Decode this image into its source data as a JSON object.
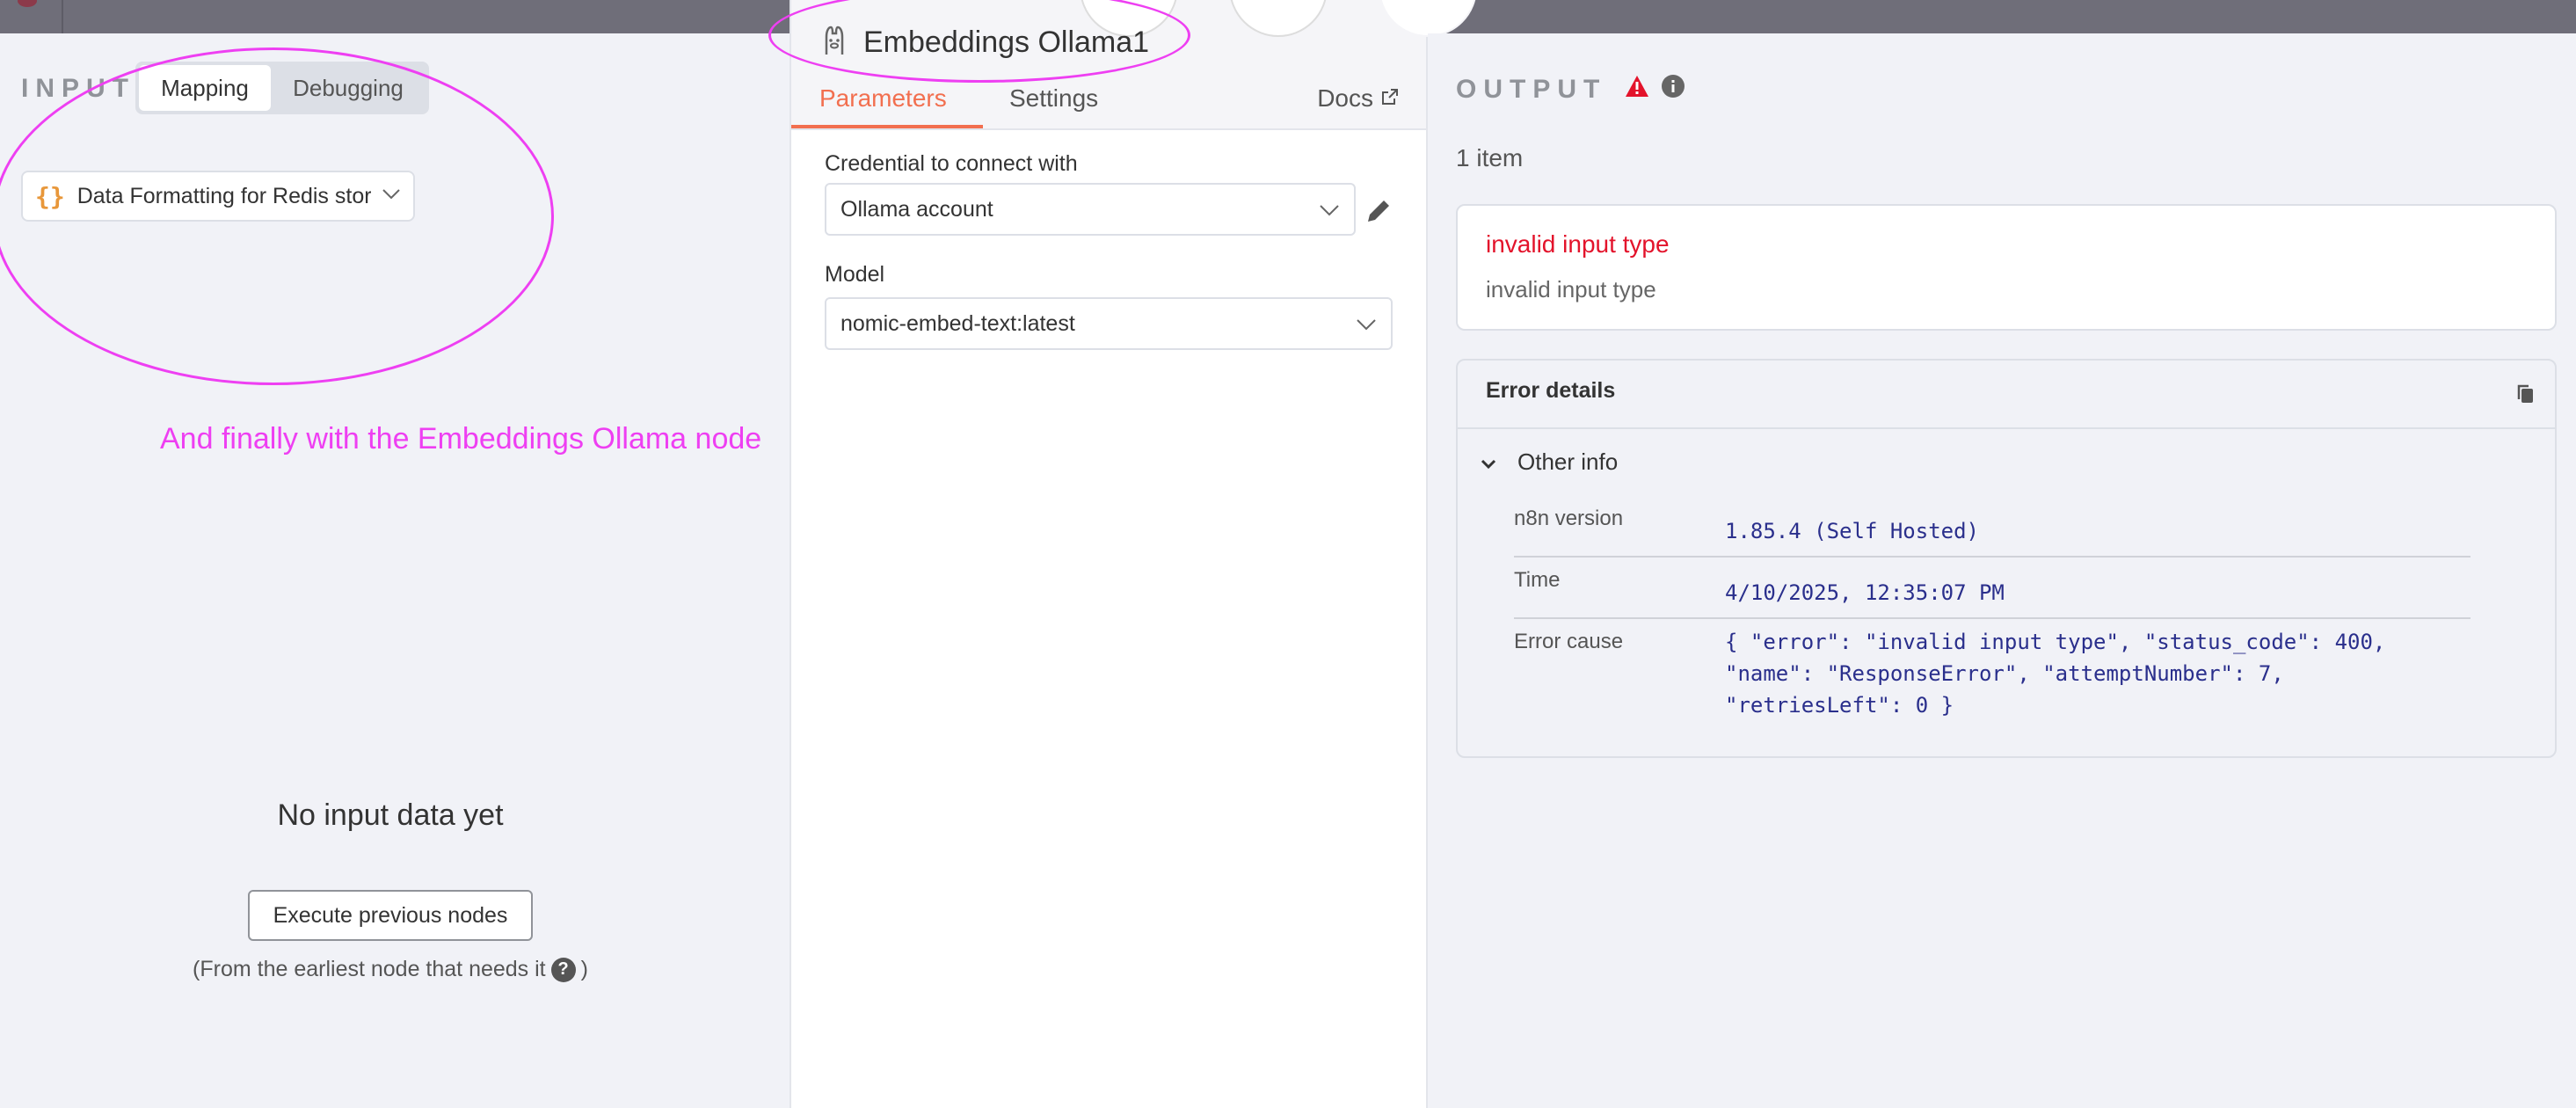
{
  "input": {
    "title": "INPUT",
    "tabs": [
      "Mapping",
      "Debugging"
    ],
    "node_select": "Data Formatting for Redis stor",
    "no_data": "No input data yet",
    "exec_button": "Execute previous nodes",
    "exec_note": "(From the earliest node that needs it",
    "exec_note_close": ")"
  },
  "annotation": {
    "text": "And finally with the Embeddings Ollama node",
    "color": "#ee3ff2"
  },
  "center": {
    "title": "Embeddings Ollama1",
    "tabs": [
      "Parameters",
      "Settings"
    ],
    "docs": "Docs",
    "credential_label": "Credential to connect with",
    "credential_value": "Ollama account",
    "model_label": "Model",
    "model_value": "nomic-embed-text:latest"
  },
  "output": {
    "title": "OUTPUT",
    "item_count": "1 item",
    "error_title": "invalid input type",
    "error_sub": "invalid input type",
    "details_title": "Error details",
    "other_info": "Other info",
    "rows": [
      {
        "key": "n8n version",
        "value": "1.85.4 (Self Hosted)"
      },
      {
        "key": "Time",
        "value": "4/10/2025, 12:35:07 PM"
      },
      {
        "key": "Error cause",
        "value": "{ \"error\": \"invalid input type\", \"status_code\": 400,\n\"name\": \"ResponseError\", \"attemptNumber\": 7,\n\"retriesLeft\": 0 }"
      }
    ]
  },
  "colors": {
    "accent": "#f26f4f",
    "error": "#e3132b",
    "mono_value": "#2a2f8c"
  }
}
